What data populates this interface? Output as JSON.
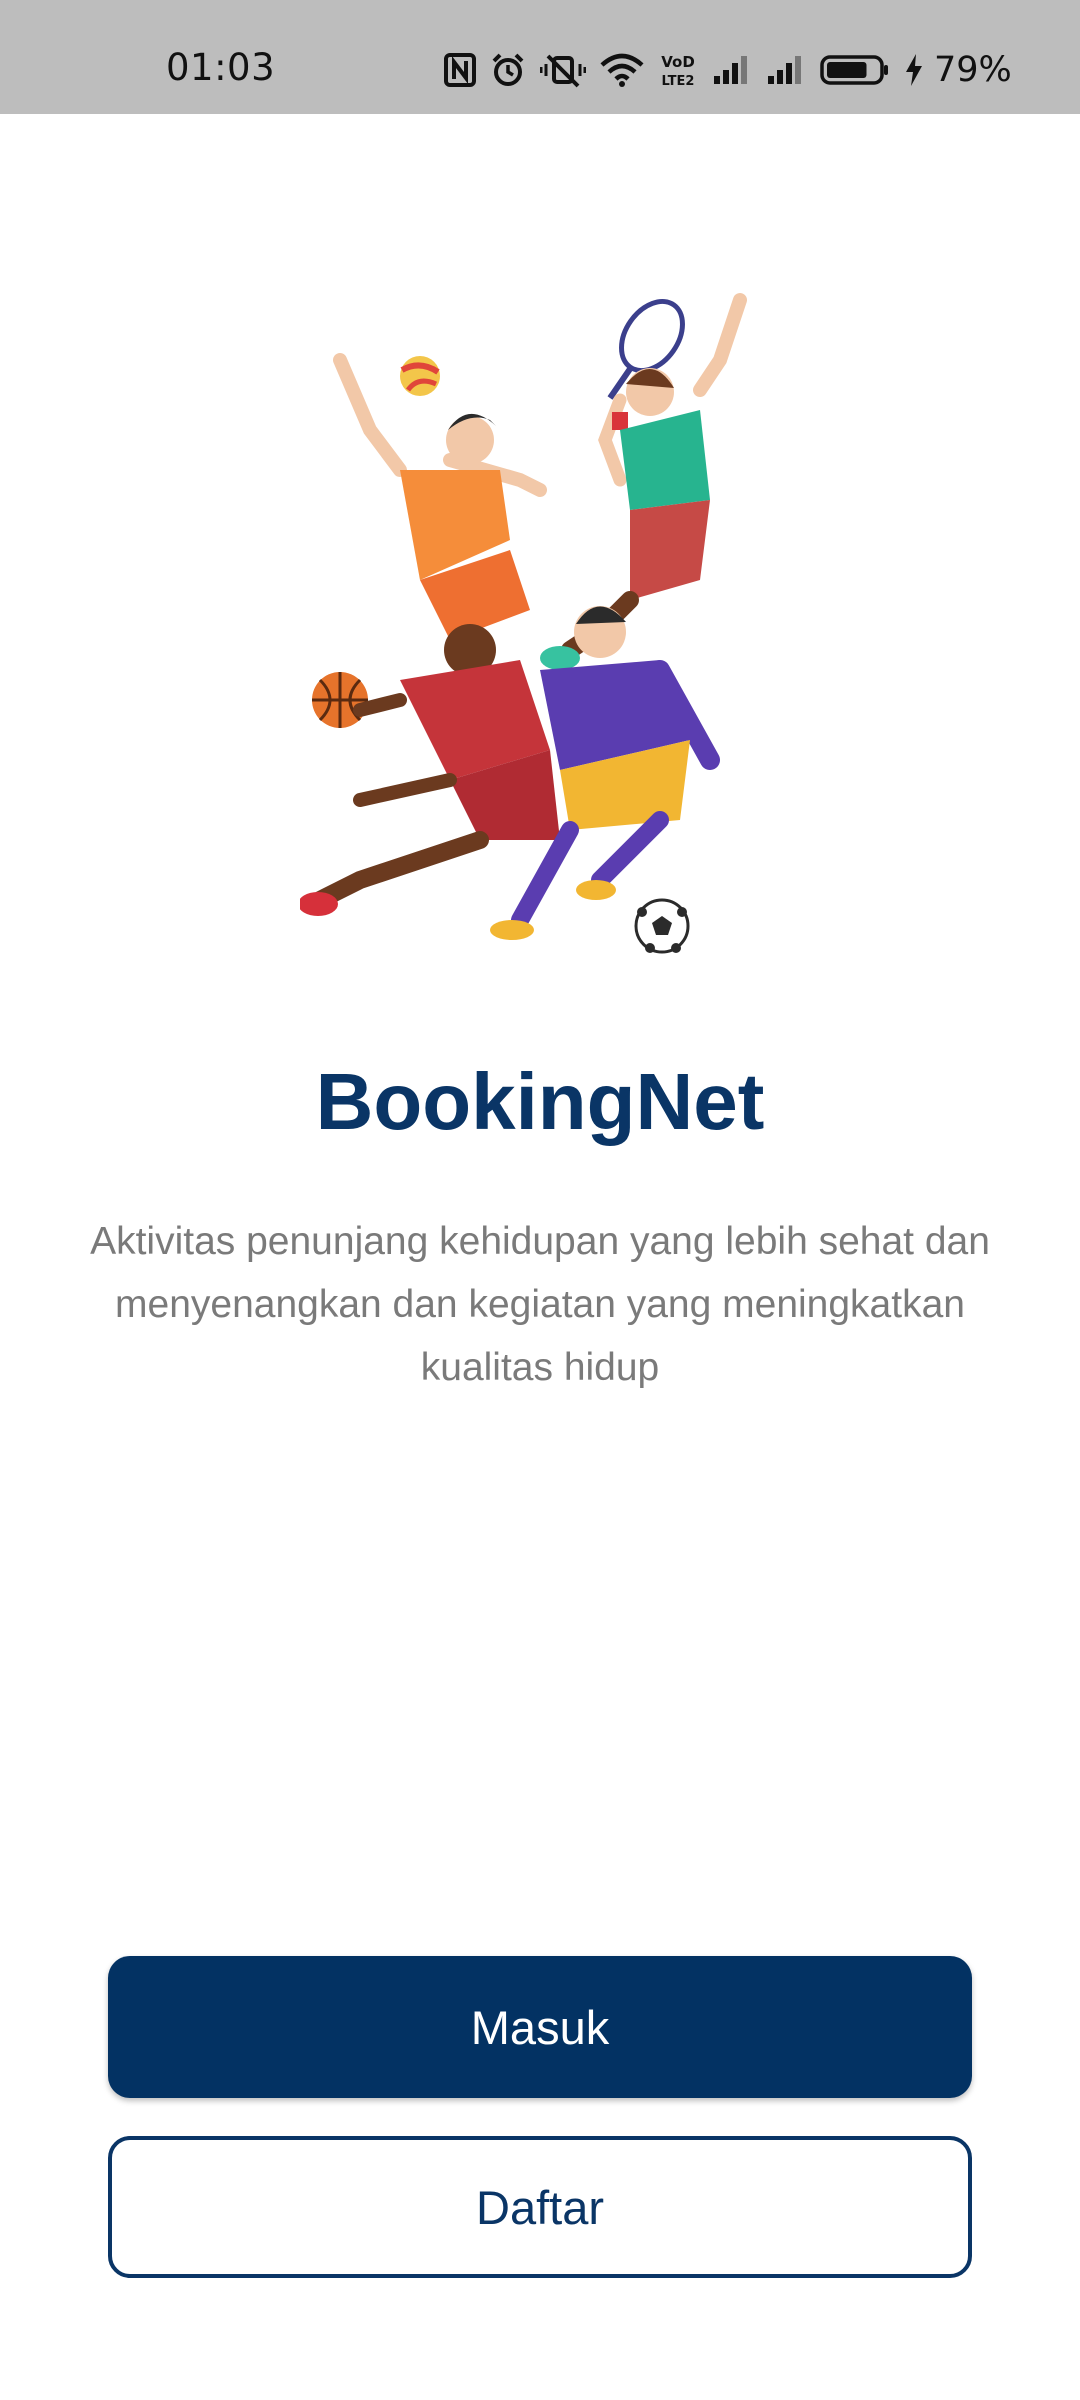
{
  "status_bar": {
    "time": "01:03",
    "battery_percent": "79%",
    "icons": [
      "nfc-icon",
      "alarm-icon",
      "vibrate-off-icon",
      "wifi-icon",
      "volte-icon",
      "signal-icon",
      "signal-icon",
      "battery-icon",
      "charging-icon"
    ],
    "battery_level": 0.79,
    "volte_label_top": "VoD",
    "volte_label_bottom": "LTE2"
  },
  "hero": {
    "illustration": "sports-players-illustration"
  },
  "welcome": {
    "title": "BookingNet",
    "subtitle": "Aktivitas penunjang kehidupan yang lebih sehat dan menyenangkan dan kegiatan yang meningkatkan kualitas hidup"
  },
  "actions": {
    "login_label": "Masuk",
    "register_label": "Daftar"
  },
  "colors": {
    "primary": "#033263",
    "title": "#0a3566",
    "subtitle": "#7a7a7a",
    "status_bar": "#bdbdbd"
  }
}
